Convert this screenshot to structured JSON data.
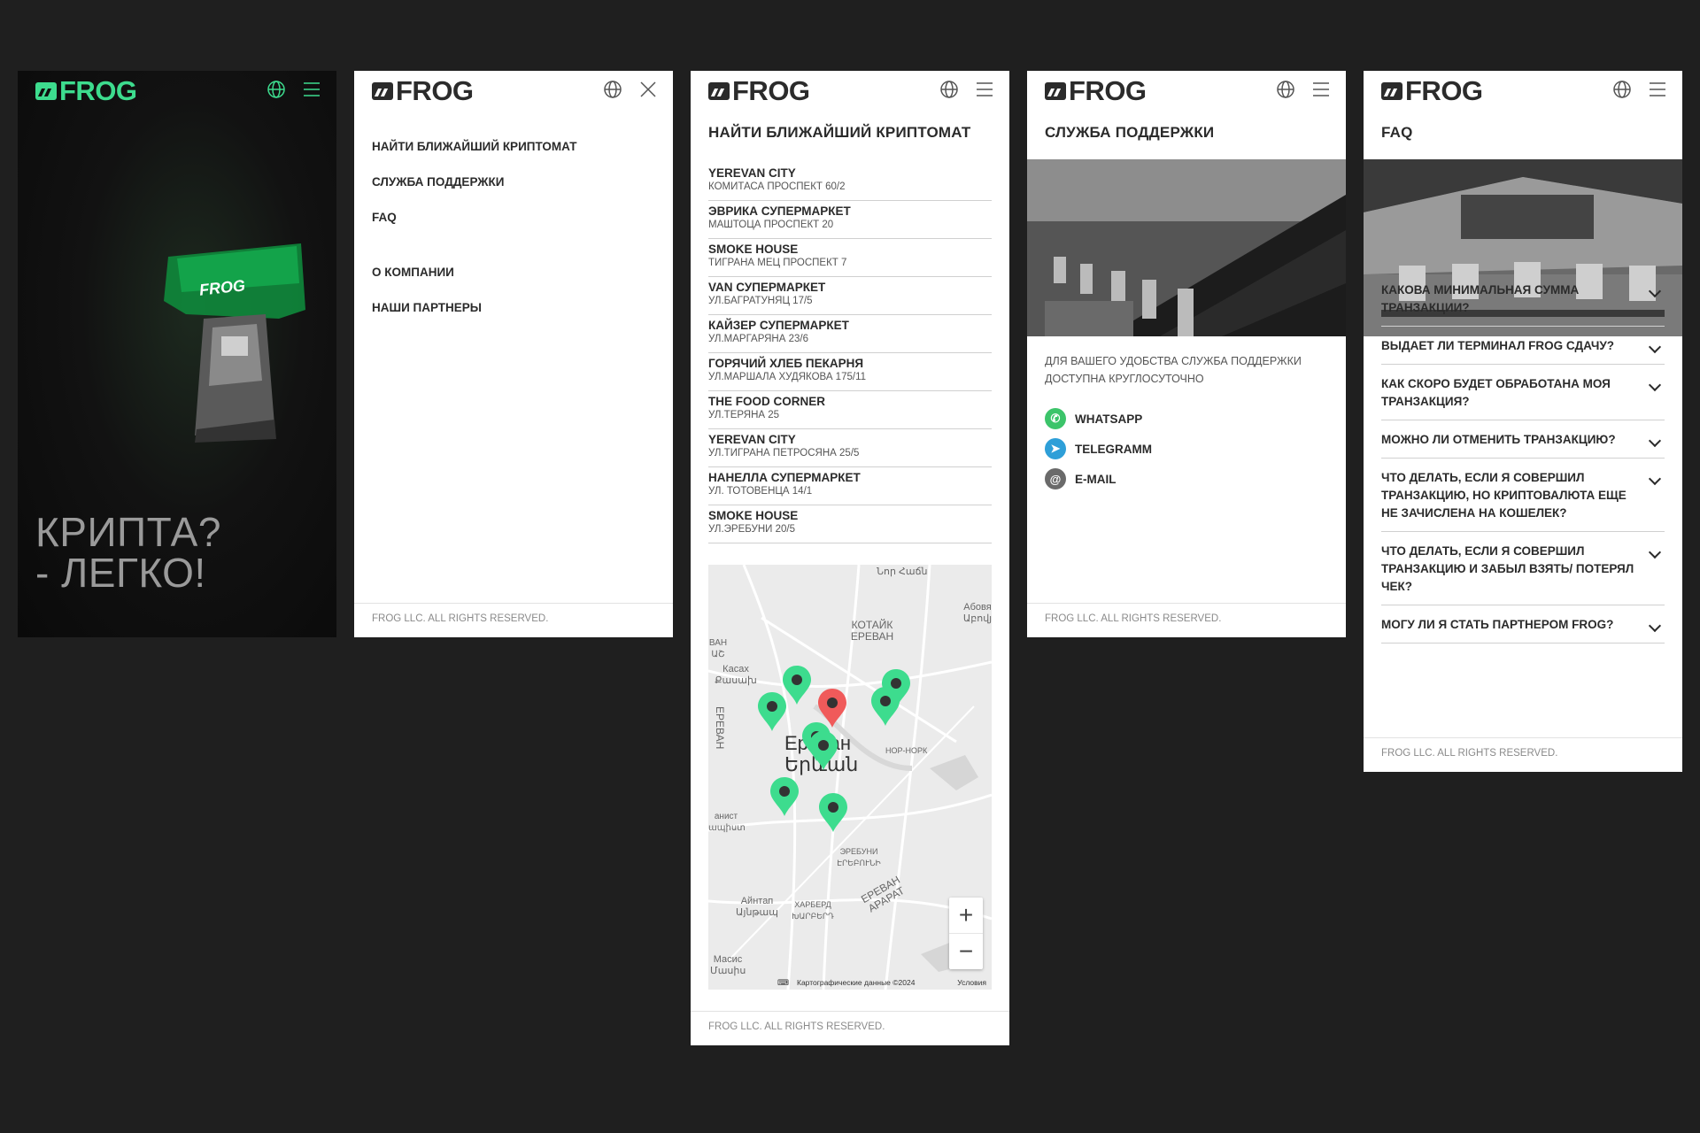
{
  "brand": {
    "name": "FROG",
    "accent": "#3ddc8e",
    "dark": "#2b2b2b"
  },
  "icons": {
    "globe": "globe-icon",
    "menu": "hamburger-menu-icon",
    "close": "close-icon",
    "chevron": "chevron-down-icon"
  },
  "home": {
    "hero_line1": "КРИПТА?",
    "hero_line2": "- ЛЕГКО!",
    "atm_sign": "FROG"
  },
  "menu": {
    "items": [
      "НАЙТИ БЛИЖАЙШИЙ КРИПТОМАТ",
      "СЛУЖБА ПОДДЕРЖКИ",
      "FAQ"
    ],
    "items2": [
      "О КОМПАНИИ",
      "НАШИ ПАРТНЕРЫ"
    ]
  },
  "footer": "FROG LLC. ALL RIGHTS RESERVED.",
  "locations": {
    "title": "НАЙТИ БЛИЖАЙШИЙ КРИПТОМАТ",
    "items": [
      {
        "name": "YEREVAN CITY",
        "address": "КОМИТАСА ПРОСПЕКТ 60/2"
      },
      {
        "name": "ЭВРИКА СУПЕРМАРКЕТ",
        "address": "МАШТОЦА ПРОСПЕКТ 20"
      },
      {
        "name": "SMOKE HOUSE",
        "address": "ТИГРАНА МЕЦ ПРОСПЕКТ 7"
      },
      {
        "name": "VAN СУПЕРМАРКЕТ",
        "address": "УЛ.БАГРАТУНЯЦ 17/5"
      },
      {
        "name": "КАЙЗЕР СУПЕРМАРКЕТ",
        "address": "УЛ.МАРГАРЯНА 23/6"
      },
      {
        "name": "ГОРЯЧИЙ ХЛЕБ ПЕКАРНЯ",
        "address": "УЛ.МАРШАЛА ХУДЯКОВА 175/11"
      },
      {
        "name": "THE FOOD CORNER",
        "address": "УЛ.ТЕРЯНА 25"
      },
      {
        "name": "YEREVAN CITY",
        "address": "УЛ.ТИГРАНА ПЕТРОСЯНА 25/5"
      },
      {
        "name": "НАНЕЛЛА СУПЕРМАРКЕТ",
        "address": "УЛ. ТОТОВЕНЦА 14/1"
      },
      {
        "name": "SMOKE HOUSE",
        "address": "УЛ.ЭРЕБУНИ 20/5"
      }
    ],
    "map": {
      "city": "Ереван",
      "city_armenian": "Երևան",
      "labels": {
        "nor_hachn": "Նոր Հաճն",
        "kotayk": "КОТАЙК ЕРЕВАН",
        "abovyan": "Абовя Աբովյ",
        "kasakh": "Касах Քասախ",
        "yerevan_vertical": "ЕРЕВАН",
        "nor_nork": "НОР-НОРК",
        "erebuni": "ЭРЕБУНИ ԷՐԵԲՈՒՆԻ",
        "aintap": "Айнтап Այնթապ",
        "kharberd": "ХАРБЕРД ԽԱՐԲԵՐԴ",
        "yerevan_ararat": "ЕРЕВАН АРАРАТ",
        "masis": "Масис Մասիս",
        "ashtarak_partial": "ВАН ԱՇ",
        "vagharshapat_partial": "анист ապիստ"
      },
      "zoom_in": "+",
      "zoom_out": "−",
      "attribution": "Картографические данные ©2024",
      "terms": "Условия",
      "pin_color": "#3ddc8e",
      "pin_selected_color": "#f05a5a"
    }
  },
  "support": {
    "title": "СЛУЖБА ПОДДЕРЖКИ",
    "text": "ДЛЯ ВАШЕГО УДОБСТВА СЛУЖБА ПОДДЕРЖКИ ДОСТУПНА КРУГЛОСУТОЧНО",
    "contacts": [
      {
        "label": "WHATSAPP",
        "icon": "whatsapp-icon",
        "color": "#3cc46a"
      },
      {
        "label": "TELEGRAMM",
        "icon": "telegram-icon",
        "color": "#2e9fd8"
      },
      {
        "label": "E-MAIL",
        "icon": "email-icon",
        "color": "#6a6a6a"
      }
    ]
  },
  "faq": {
    "title": "FAQ",
    "items": [
      "КАКОВА МИНИМАЛЬНАЯ СУММА ТРАНЗАКЦИИ?",
      "ВЫДАЕТ ЛИ ТЕРМИНАЛ FROG СДАЧУ?",
      "КАК СКОРО БУДЕТ ОБРАБОТАНА МОЯ ТРАНЗАКЦИЯ?",
      "МОЖНО ЛИ ОТМЕНИТЬ ТРАНЗАКЦИЮ?",
      "ЧТО ДЕЛАТЬ, ЕСЛИ Я СОВЕРШИЛ ТРАНЗАКЦИЮ, НО КРИПТОВАЛЮТА ЕЩЕ НЕ ЗАЧИСЛЕНА НА КОШЕЛЕК?",
      "ЧТО ДЕЛАТЬ, ЕСЛИ Я СОВЕРШИЛ ТРАНЗАКЦИЮ И ЗАБЫЛ ВЗЯТЬ/ ПОТЕРЯЛ ЧЕК?",
      "МОГУ ЛИ Я СТАТЬ ПАРТНЕРОМ FROG?"
    ]
  }
}
